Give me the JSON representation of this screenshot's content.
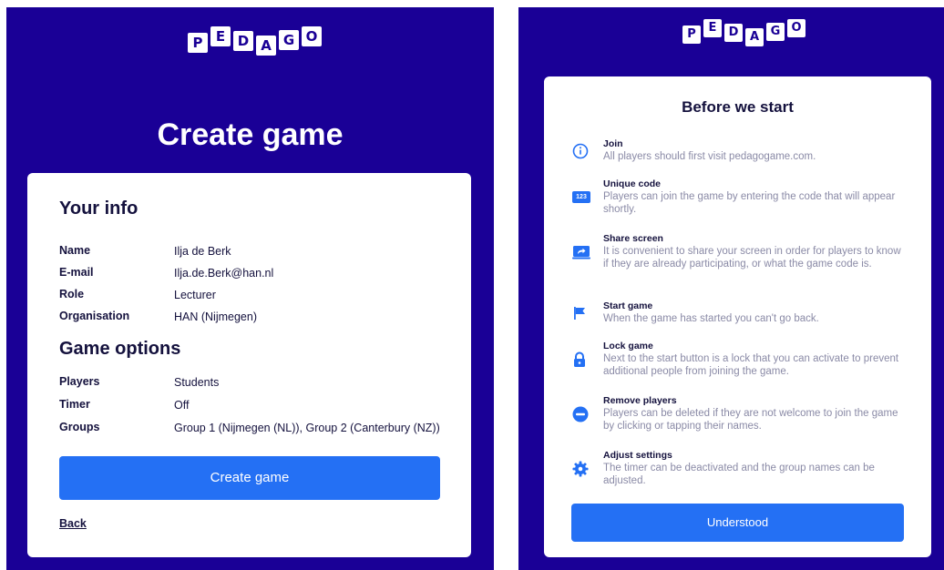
{
  "brand": {
    "letters": [
      "P",
      "E",
      "D",
      "A",
      "G",
      "O"
    ],
    "background_color": "#1a0096",
    "accent_color": "#2470f4"
  },
  "left": {
    "page_title": "Create game",
    "your_info": {
      "title": "Your info",
      "rows": [
        {
          "label": "Name",
          "value": "Ilja de Berk"
        },
        {
          "label": "E-mail",
          "value": "Ilja.de.Berk@han.nl"
        },
        {
          "label": "Role",
          "value": "Lecturer"
        },
        {
          "label": "Organisation",
          "value": "HAN (Nijmegen)"
        }
      ]
    },
    "game_options": {
      "title": "Game options",
      "rows": [
        {
          "label": "Players",
          "value": "Students"
        },
        {
          "label": "Timer",
          "value": "Off"
        },
        {
          "label": "Groups",
          "value": "Group 1 (Nijmegen (NL)), Group 2 (Canterbury (NZ))"
        }
      ]
    },
    "create_button": "Create game",
    "back_link": "Back"
  },
  "right": {
    "title": "Before we start",
    "tips": [
      {
        "icon": "info-icon",
        "heading": "Join",
        "text": "All players should first visit pedagogame.com."
      },
      {
        "icon": "number-code-icon",
        "heading": "Unique code",
        "text": "Players can join the game by entering the code that will appear shortly."
      },
      {
        "icon": "share-screen-icon",
        "heading": "Share screen",
        "text": "It is convenient to share your screen in order for players to know if they are already participating, or what the game code is."
      },
      {
        "icon": "flag-icon",
        "heading": "Start game",
        "text": "When the game has started you can't go back."
      },
      {
        "icon": "lock-icon",
        "heading": "Lock game",
        "text": "Next to the start button is a lock that you can activate to prevent additional people from joining the game."
      },
      {
        "icon": "minus-circle-icon",
        "heading": "Remove players",
        "text": "Players can be deleted if they are not welcome to join the game by clicking or tapping their names."
      },
      {
        "icon": "gear-icon",
        "heading": "Adjust settings",
        "text": "The timer can be deactivated and the group names can be adjusted."
      }
    ],
    "number_icon_text": "123",
    "understood_button": "Understood"
  }
}
